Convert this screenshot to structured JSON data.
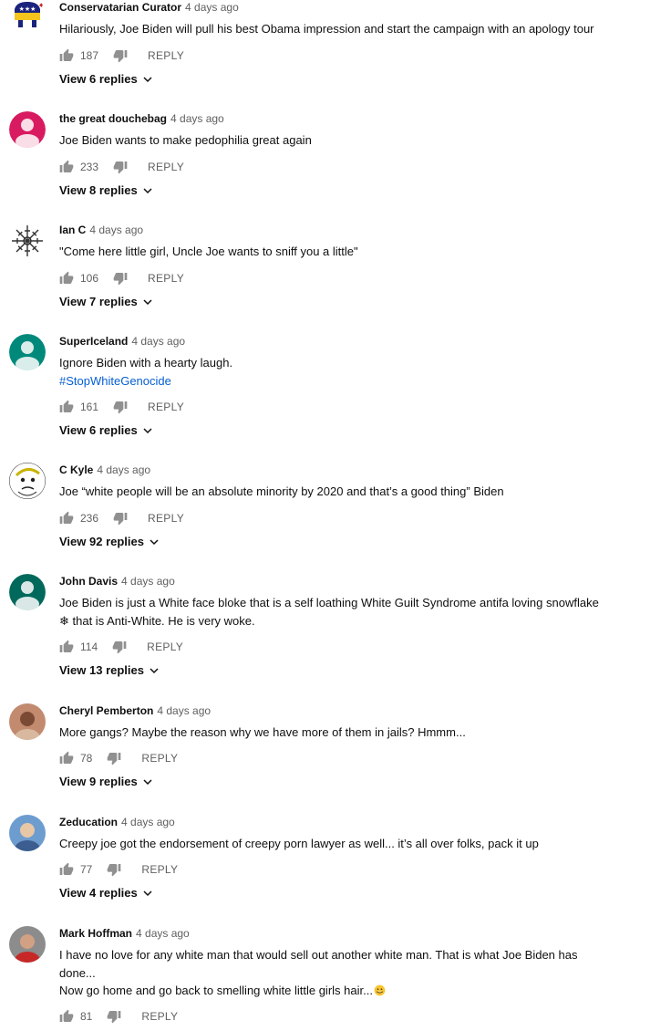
{
  "labels": {
    "reply": "REPLY"
  },
  "colors": {
    "hashtag": "#065fd4",
    "meta": "#606060"
  },
  "comments": [
    {
      "author": "Conservatarian Curator",
      "time": "4 days ago",
      "text": [
        "Hilariously, Joe Biden will pull his best Obama impression and start the campaign with an apology tour"
      ],
      "likes": "187",
      "view_replies": "View 6 replies",
      "avatar_icon": "elephant-logo-icon"
    },
    {
      "author": "the great douchebag",
      "time": "4 days ago",
      "text": [
        "Joe Biden wants to make pedophilia great again"
      ],
      "likes": "233",
      "view_replies": "View 8 replies",
      "avatar_icon": "default-user-icon",
      "avatar_color": "#d81b60"
    },
    {
      "author": "Ian C",
      "time": "4 days ago",
      "text": [
        "\"Come here little girl, Uncle Joe wants to sniff you a little\""
      ],
      "likes": "106",
      "view_replies": "View 7 replies",
      "avatar_icon": "rune-symbol-icon"
    },
    {
      "author": "SuperIceland",
      "time": "4 days ago",
      "text": [
        "Ignore Biden with a hearty laugh."
      ],
      "hashtag": "#StopWhiteGenocide",
      "likes": "161",
      "view_replies": "View 6 replies",
      "avatar_icon": "default-user-icon",
      "avatar_color": "#00897b"
    },
    {
      "author": "C Kyle",
      "time": "4 days ago",
      "text": [
        "Joe “white people will be an absolute minority by 2020 and that’s a good thing” Biden"
      ],
      "likes": "236",
      "view_replies": "View 92 replies",
      "avatar_icon": "cartoon-face-icon"
    },
    {
      "author": "John Davis",
      "time": "4 days ago",
      "text": [
        "Joe Biden is just a White face bloke that is a self loathing White Guilt Syndrome antifa loving snowflake",
        "❄ that is Anti-White. He is very woke."
      ],
      "likes": "114",
      "view_replies": "View 13 replies",
      "avatar_icon": "default-user-icon",
      "avatar_color": "#00695c"
    },
    {
      "author": "Cheryl Pemberton",
      "time": "4 days ago",
      "text": [
        "More gangs? Maybe the reason why we have more of them in jails? Hmmm..."
      ],
      "likes": "78",
      "view_replies": "View 9 replies",
      "avatar_icon": "photo-avatar-icon"
    },
    {
      "author": "Zeducation",
      "time": "4 days ago",
      "text": [
        "Creepy joe got the endorsement of creepy porn lawyer as well... it’s all over folks, pack it up"
      ],
      "likes": "77",
      "view_replies": "View 4 replies",
      "avatar_icon": "photo-avatar-icon"
    },
    {
      "author": "Mark Hoffman",
      "time": "4 days ago",
      "text": [
        "I have no love for any white man that would sell out another white man. That is what Joe Biden has",
        "done...",
        "Now go home and go back to smelling white little girls hair..."
      ],
      "likes": "81",
      "avatar_icon": "photo-avatar-icon"
    }
  ]
}
